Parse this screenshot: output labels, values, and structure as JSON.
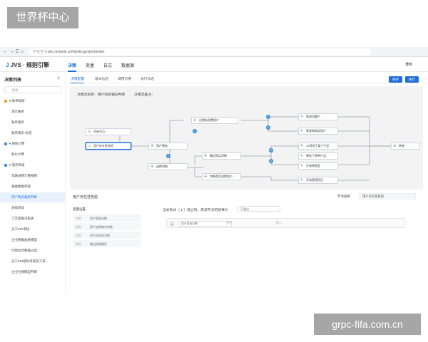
{
  "watermark_top": "世界杯中心",
  "watermark_bottom": "grpc-fifa.com.cn",
  "browser": {
    "nav_glyphs": "← → C ⌂",
    "security_label": "不安全",
    "url": "rules.bctools.cn/#/policyproject/index"
  },
  "app": {
    "logo_mark": "J",
    "logo_text": "JVS · 规则引擎",
    "nav": [
      "决策",
      "变量",
      "日志",
      "数据源"
    ],
    "user_name": "薄世"
  },
  "sidebar": {
    "title": "决策列表",
    "add_glyph": "+",
    "search_placeholder": "搜索",
    "items": [
      {
        "label": "▾ 账单规则",
        "color": "#f59b2b",
        "selected": false
      },
      {
        "label": "演示账单",
        "color": "",
        "selected": false
      },
      {
        "label": "账单演示",
        "color": "",
        "selected": false
      },
      {
        "label": "账单演示-标签",
        "color": "",
        "selected": false
      },
      {
        "label": "▾ 预估计费",
        "color": "#3b8de0",
        "selected": false
      },
      {
        "label": "新价计费",
        "color": "",
        "selected": false
      },
      {
        "label": "▾ 演示目录",
        "color": "#3b8de0",
        "selected": false
      },
      {
        "label": "车辆油费计算规则",
        "color": "",
        "selected": false
      },
      {
        "label": "金融数据审核",
        "color": "",
        "selected": false
      },
      {
        "label": "用户购买偏好判断",
        "color": "",
        "selected": true
      },
      {
        "label": "休假测试",
        "color": "",
        "selected": false
      },
      {
        "label": "工艺超限决策表",
        "color": "",
        "selected": false
      },
      {
        "label": "员工KPI考核",
        "color": "",
        "selected": false
      },
      {
        "label": "企业数据画质模型",
        "color": "",
        "selected": false
      },
      {
        "label": "行政处罚数据过滤",
        "color": "",
        "selected": false
      },
      {
        "label": "员工KPI绩效考核及工资...",
        "color": "",
        "selected": false
      },
      {
        "label": "企业社保模型判断",
        "color": "",
        "selected": false
      }
    ]
  },
  "tabs": [
    "决策配置",
    "基本信息",
    "调用示例",
    "执行日志"
  ],
  "buttons": {
    "save": "保存",
    "run": "执行"
  },
  "canvas": {
    "name_label": "决策流名称：用户购买偏向判断",
    "remark_label": "决策流备注：",
    "nodes": {
      "start": "开始节点",
      "check": "用户存在性校验",
      "split1": "用户筛选",
      "merge1": "选择判断",
      "recent": "近期有消费用户",
      "recent_buy": "最近购买判断",
      "no_buy": "判断是否消费用户",
      "r1": "登录问题户",
      "r2": "登录和购买用户",
      "r3": "10项低于某个产品",
      "r4": "降低了多种产品",
      "r5": "开始原理会",
      "r6": "开始直接项目",
      "end": "结束"
    },
    "badges": [
      "1",
      "2",
      "3",
      "4",
      "5",
      "6"
    ]
  },
  "panel": {
    "title": "用户存在性校验",
    "node_name_label": "节点名称",
    "node_name_value": "用户存在性校验",
    "vars_title": "变量设置",
    "variables": [
      {
        "type": "实时",
        "name": "用户登录次数"
      },
      {
        "type": "实时",
        "name": "用户加购物车的数"
      },
      {
        "type": "实时",
        "name": "用户浏览该次数"
      },
      {
        "type": "实时",
        "name": "输出结果顺序"
      }
    ],
    "condition_text": "当关系式（ 1 ）成立时，则该节点的结果为",
    "condition_select": "不通过",
    "row": {
      "index": "1",
      "field": "用户登录次数",
      "operator": "大于",
      "value": "输入"
    }
  }
}
